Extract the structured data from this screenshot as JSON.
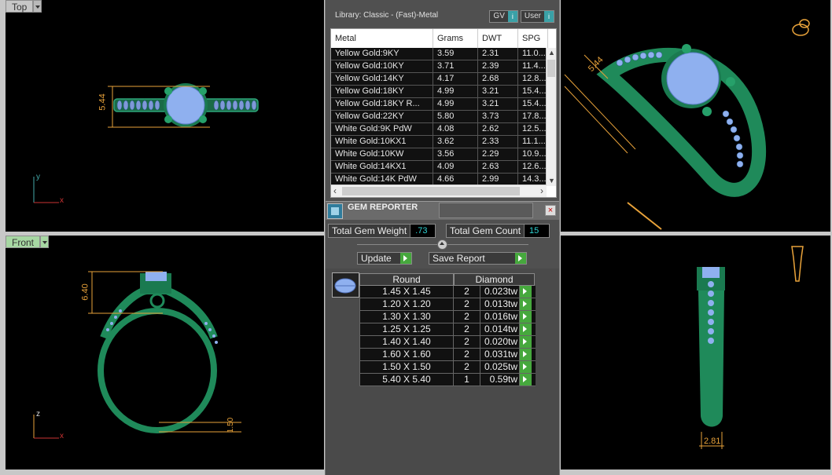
{
  "viewports": {
    "top": {
      "label": "Top",
      "dim": "5.44",
      "axis_v": "y",
      "axis_h": "x"
    },
    "front": {
      "label": "Front",
      "dim": "6.40",
      "dim_bottom": "1.50",
      "axis_v": "z",
      "axis_h": "x"
    },
    "perspective": {
      "dim": "5.44"
    },
    "right": {
      "dim": "2.81"
    }
  },
  "library": {
    "title": "Library: Classic - (Fast)-Metal",
    "btn_gv": "GV",
    "btn_user": "User",
    "btn_info": "i",
    "columns": [
      "Metal",
      "Grams",
      "DWT",
      "SPG"
    ],
    "rows": [
      [
        "Yellow Gold:9KY",
        "3.59",
        "2.31",
        "11.0..."
      ],
      [
        "Yellow Gold:10KY",
        "3.71",
        "2.39",
        "11.4..."
      ],
      [
        "Yellow Gold:14KY",
        "4.17",
        "2.68",
        "12.8..."
      ],
      [
        "Yellow Gold:18KY",
        "4.99",
        "3.21",
        "15.4..."
      ],
      [
        "Yellow Gold:18KY R...",
        "4.99",
        "3.21",
        "15.4..."
      ],
      [
        "Yellow Gold:22KY",
        "5.80",
        "3.73",
        "17.8..."
      ],
      [
        "White Gold:9K PdW",
        "4.08",
        "2.62",
        "12.5..."
      ],
      [
        "White Gold:10KX1",
        "3.62",
        "2.33",
        "11.1..."
      ],
      [
        "White Gold:10KW",
        "3.56",
        "2.29",
        "10.9..."
      ],
      [
        "White Gold:14KX1",
        "4.09",
        "2.63",
        "12.6..."
      ],
      [
        "White Gold:14K PdW",
        "4.66",
        "2.99",
        "14.3..."
      ]
    ]
  },
  "gem_reporter": {
    "title": "GEM REPORTER",
    "close": "×",
    "total_weight_label": "Total Gem Weight",
    "total_weight_value": ".73",
    "total_count_label": "Total Gem Count",
    "total_count_value": "15",
    "update_label": "Update",
    "save_label": "Save Report",
    "shape_header": "Round",
    "type_header": "Diamond",
    "gems": [
      [
        "1.45 X 1.45",
        "2",
        "0.023tw"
      ],
      [
        "1.20 X 1.20",
        "2",
        "0.013tw"
      ],
      [
        "1.30 X 1.30",
        "2",
        "0.016tw"
      ],
      [
        "1.25 X 1.25",
        "2",
        "0.014tw"
      ],
      [
        "1.40 X 1.40",
        "2",
        "0.020tw"
      ],
      [
        "1.60 X 1.60",
        "2",
        "0.031tw"
      ],
      [
        "1.50 X 1.50",
        "2",
        "0.025tw"
      ],
      [
        "5.40 X 5.40",
        "1",
        "0.59tw"
      ]
    ]
  },
  "colors": {
    "metal": "#1f8a5a",
    "gem": "#8fb0ef",
    "dimension": "#e8a23a"
  }
}
